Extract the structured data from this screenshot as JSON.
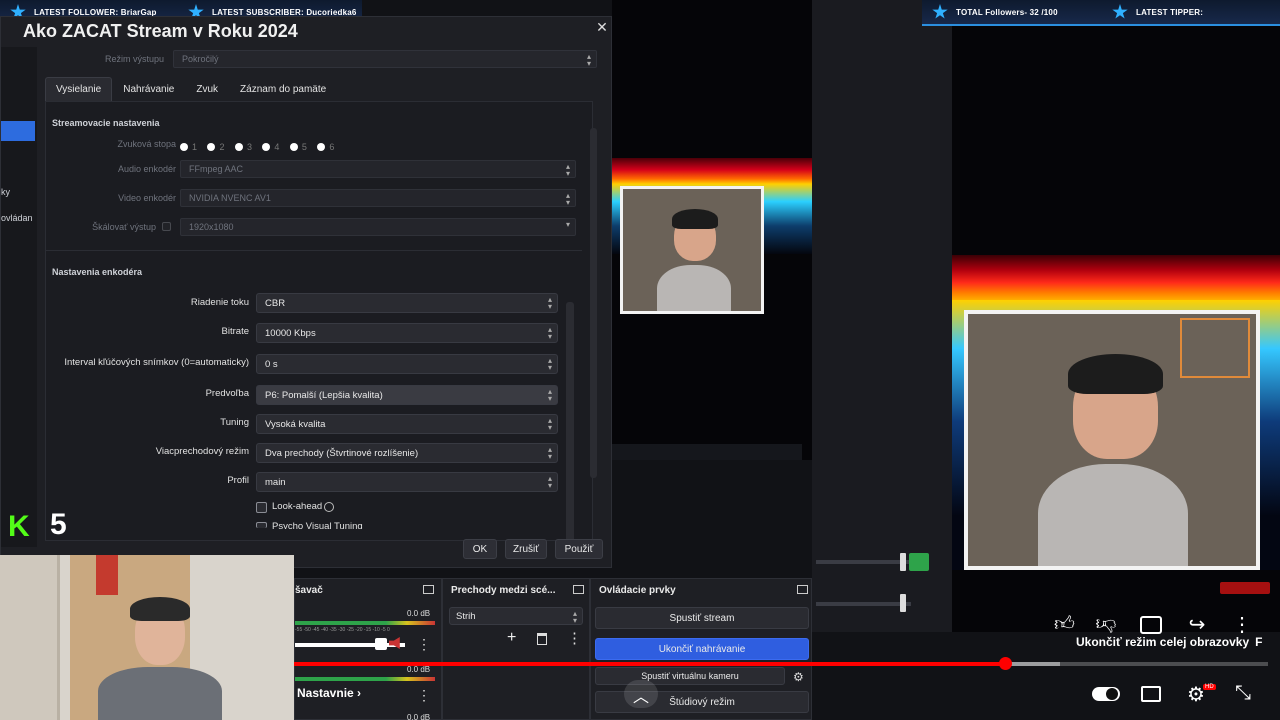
{
  "banners": {
    "latest_follower": "LATEST FOLLOWER: BriarGap",
    "latest_subscriber": "LATEST SUBSCRIBER: Ducoriedka6",
    "total_followers": "TOTAL Followers- 32 /100",
    "latest_tipper": "LATEST TIPPER:"
  },
  "dialog": {
    "title": "Ako ZACAT Stream v Roku 2024",
    "close_glyph": "✕",
    "sidebar_fragments": [
      "ky",
      "ovládan"
    ],
    "output_mode_label": "Režim výstupu",
    "output_mode_value": "Pokročilý",
    "tabs": [
      "Vysielanie",
      "Nahrávanie",
      "Zvuk",
      "Záznam do pamäte"
    ],
    "streaming_section": "Streamovacie nastavenia",
    "audio_track_label": "Zvuková stopa",
    "audio_tracks": [
      "1",
      "2",
      "3",
      "4",
      "5",
      "6"
    ],
    "audio_encoder_label": "Audio enkodér",
    "audio_encoder_value": "FFmpeg AAC",
    "video_encoder_label": "Video enkodér",
    "video_encoder_value": "NVIDIA NVENC AV1",
    "scale_label": "Škálovať výstup",
    "scale_value": "1920x1080",
    "encoder_section": "Nastavenia enkodéra",
    "rate_control_label": "Riadenie toku",
    "rate_control_value": "CBR",
    "bitrate_label": "Bitrate",
    "bitrate_value": "10000 Kbps",
    "keyframe_label": "Interval kľúčových snímkov (0=automaticky)",
    "keyframe_value": "0 s",
    "preset_label": "Predvoľba",
    "preset_value": "P6: Pomalší (Lepšia kvalita)",
    "tuning_label": "Tuning",
    "tuning_value": "Vysoká kvalita",
    "multipass_label": "Viacprechodový režim",
    "multipass_value": "Dva prechody (Štvrtinové rozlíšenie)",
    "profile_label": "Profil",
    "profile_value": "main",
    "lookahead_label": "Look-ahead",
    "psycho_label": "Psycho Visual Tuning",
    "ok": "OK",
    "cancel": "Zrušiť",
    "apply": "Použiť"
  },
  "docks": {
    "mixer_title": "šavač",
    "mixer_db": "0.0 dB",
    "mixer_db2": "0.0 dB",
    "mixer_scale": "-55 -50 -45 -40 -35 -30 -25 -20 -15 -10 -5 0",
    "transitions_title": "Prechody medzi scé...",
    "transition_value": "Strih",
    "controls_title": "Ovládacie prvky",
    "start_stream": "Spustiť stream",
    "stop_recording": "Ukončiť nahrávanie",
    "start_virtualcam": "Spustiť virtuálnu kameru",
    "studio_mode": "Štúdiový režim"
  },
  "kick": {
    "logo": "K",
    "count": "5"
  },
  "youtube": {
    "progress_fraction": 0.73,
    "chapter_label": "Nastavnie",
    "fullscreen_tooltip": "Ukončiť režim celej obrazovky",
    "fullscreen_key": "F",
    "hd_badge": "HD"
  },
  "colors": {
    "obs_accent": "#2d6cdf",
    "yt_red": "#ff0000",
    "kick_green": "#53fc18",
    "banner_blue": "#2b8fe0"
  }
}
